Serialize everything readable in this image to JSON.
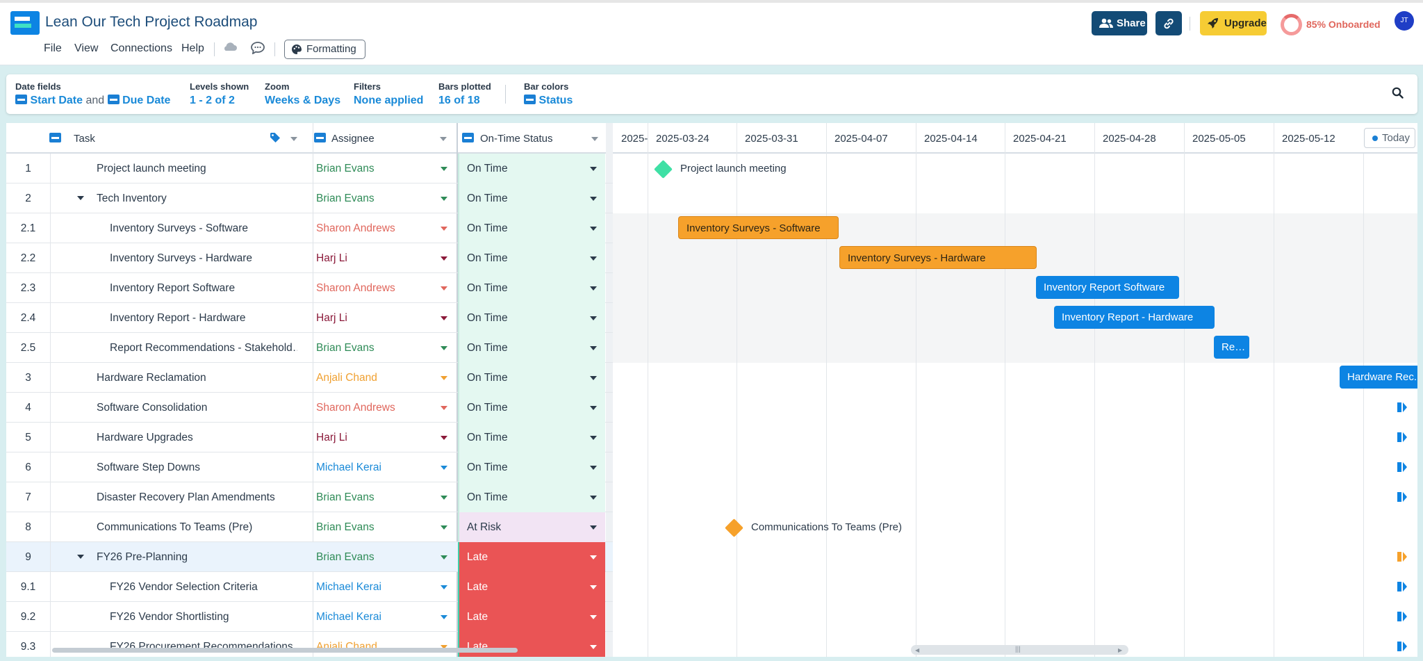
{
  "app": {
    "title": "Lean Our Tech Project Roadmap"
  },
  "menu": [
    "File",
    "View",
    "Connections",
    "Help"
  ],
  "toolbar": {
    "formatting": "Formatting",
    "share": "Share",
    "upgrade": "Upgrade",
    "onboarded": "85% Onboarded",
    "avatar": "JT"
  },
  "settings": {
    "date_fields": {
      "label": "Date fields",
      "start": "Start Date",
      "and": "and",
      "due": "Due Date"
    },
    "levels": {
      "label": "Levels shown",
      "value": "1 - 2 of 2"
    },
    "zoom": {
      "label": "Zoom",
      "value": "Weeks & Days"
    },
    "filters": {
      "label": "Filters",
      "value": "None applied"
    },
    "bars": {
      "label": "Bars plotted",
      "value": "16 of 18"
    },
    "colors": {
      "label": "Bar colors",
      "value": "Status"
    }
  },
  "columns": {
    "task": "Task",
    "assignee": "Assignee",
    "status": "On-Time Status"
  },
  "timeline": {
    "weeks": [
      "2025-",
      "2025-03-24",
      "2025-03-31",
      "2025-04-07",
      "2025-04-14",
      "2025-04-21",
      "2025-04-28",
      "2025-05-05",
      "2025-05-12"
    ],
    "today": "Today"
  },
  "colors": {
    "on_time": "#e4f8f1",
    "at_risk": "#f2e4f4",
    "late": "#ea5455",
    "bar_orange": "#f6a12b",
    "bar_blue": "#0d84e3",
    "brian": "#2e8b57",
    "sharon": "#e0665c",
    "harj": "#8b1a3a",
    "anjali": "#f0a030",
    "michael": "#1a8ad8"
  },
  "rows": [
    {
      "num": "1",
      "task": "Project launch meeting",
      "assignee": "Brian Evans",
      "status": "On Time"
    },
    {
      "num": "2",
      "task": "Tech Inventory",
      "assignee": "Brian Evans",
      "status": "On Time"
    },
    {
      "num": "2.1",
      "task": "Inventory Surveys - Software",
      "assignee": "Sharon Andrews",
      "status": "On Time"
    },
    {
      "num": "2.2",
      "task": "Inventory Surveys - Hardware",
      "assignee": "Harj Li",
      "status": "On Time"
    },
    {
      "num": "2.3",
      "task": "Inventory Report Software",
      "assignee": "Sharon Andrews",
      "status": "On Time"
    },
    {
      "num": "2.4",
      "task": "Inventory Report - Hardware",
      "assignee": "Harj Li",
      "status": "On Time"
    },
    {
      "num": "2.5",
      "task": "Report Recommendations - Stakehold…",
      "assignee": "Brian Evans",
      "status": "On Time"
    },
    {
      "num": "3",
      "task": "Hardware Reclamation",
      "assignee": "Anjali Chand",
      "status": "On Time"
    },
    {
      "num": "4",
      "task": "Software Consolidation",
      "assignee": "Sharon Andrews",
      "status": "On Time"
    },
    {
      "num": "5",
      "task": "Hardware Upgrades",
      "assignee": "Harj Li",
      "status": "On Time"
    },
    {
      "num": "6",
      "task": "Software Step Downs",
      "assignee": "Michael Kerai",
      "status": "On Time"
    },
    {
      "num": "7",
      "task": "Disaster Recovery Plan Amendments",
      "assignee": "Brian Evans",
      "status": "On Time"
    },
    {
      "num": "8",
      "task": "Communications To Teams (Pre)",
      "assignee": "Brian Evans",
      "status": "At Risk"
    },
    {
      "num": "9",
      "task": "FY26 Pre-Planning",
      "assignee": "Brian Evans",
      "status": "Late"
    },
    {
      "num": "9.1",
      "task": "FY26 Vendor Selection Criteria",
      "assignee": "Michael Kerai",
      "status": "Late"
    },
    {
      "num": "9.2",
      "task": "FY26 Vendor Shortlisting",
      "assignee": "Michael Kerai",
      "status": "Late"
    },
    {
      "num": "9.3",
      "task": "FY26 Procurement Recommendations",
      "assignee": "Anjali Chand",
      "status": "Late"
    }
  ],
  "bars": {
    "m1": "Project launch meeting",
    "b21": "Inventory Surveys - Software",
    "b22": "Inventory Surveys - Hardware",
    "b23": "Inventory Report Software",
    "b24": "Inventory Report - Hardware",
    "b25": "Rep...",
    "b3": "Hardware Rec...",
    "m8": "Communications To Teams (Pre)"
  }
}
